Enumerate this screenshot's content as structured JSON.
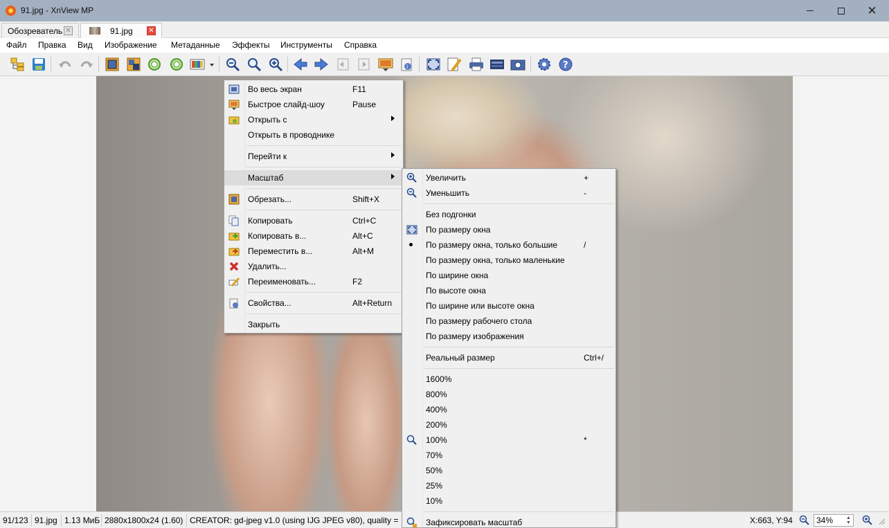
{
  "window": {
    "title": "91.jpg - XnView MP"
  },
  "tabs": [
    {
      "label": "Обозреватель"
    },
    {
      "label": "91.jpg"
    }
  ],
  "menubar": [
    "Файл",
    "Правка",
    "Вид",
    "Изображение",
    "Метаданные",
    "Эффекты",
    "Инструменты",
    "Справка"
  ],
  "context_menu": {
    "items": [
      {
        "label": "Во весь экран",
        "shortcut": "F11",
        "icon": "fullscreen-icon"
      },
      {
        "label": "Быстрое слайд-шоу",
        "shortcut": "Pause",
        "icon": "slideshow-icon"
      },
      {
        "label": "Открыть с",
        "shortcut": "",
        "icon": "open-with-icon"
      },
      {
        "label": "Открыть в проводнике",
        "shortcut": ""
      },
      {
        "label": "Перейти к",
        "shortcut": ""
      },
      {
        "label": "Масштаб",
        "shortcut": ""
      },
      {
        "label": "Обрезать...",
        "shortcut": "Shift+X",
        "icon": "crop-icon"
      },
      {
        "label": "Копировать",
        "shortcut": "Ctrl+C",
        "icon": "copy-icon"
      },
      {
        "label": "Копировать в...",
        "shortcut": "Alt+C",
        "icon": "copy-to-icon"
      },
      {
        "label": "Переместить в...",
        "shortcut": "Alt+M",
        "icon": "move-to-icon"
      },
      {
        "label": "Удалить...",
        "shortcut": "",
        "icon": "delete-icon"
      },
      {
        "label": "Переименовать...",
        "shortcut": "F2",
        "icon": "rename-icon"
      },
      {
        "label": "Свойства...",
        "shortcut": "Alt+Return",
        "icon": "properties-icon"
      },
      {
        "label": "Закрыть",
        "shortcut": ""
      }
    ]
  },
  "zoom_submenu": {
    "items": [
      {
        "label": "Увеличить",
        "shortcut": "+",
        "icon": "zoom-in-icon"
      },
      {
        "label": "Уменьшить",
        "shortcut": "-",
        "icon": "zoom-out-icon"
      },
      {
        "label": "Без подгонки",
        "shortcut": ""
      },
      {
        "label": "По размеру окна",
        "shortcut": "",
        "icon": "fit-window-icon"
      },
      {
        "label": "По размеру окна, только большие",
        "shortcut": "/",
        "selected": true
      },
      {
        "label": "По размеру окна, только маленькие",
        "shortcut": ""
      },
      {
        "label": "По ширине окна",
        "shortcut": ""
      },
      {
        "label": "По высоте окна",
        "shortcut": ""
      },
      {
        "label": "По ширине или высоте окна",
        "shortcut": ""
      },
      {
        "label": "По размеру рабочего стола",
        "shortcut": ""
      },
      {
        "label": "По размеру изображения",
        "shortcut": ""
      },
      {
        "label": "Реальный размер",
        "shortcut": "Ctrl+/"
      },
      {
        "label": "1600%",
        "shortcut": ""
      },
      {
        "label": "800%",
        "shortcut": ""
      },
      {
        "label": "400%",
        "shortcut": ""
      },
      {
        "label": "200%",
        "shortcut": ""
      },
      {
        "label": "100%",
        "shortcut": "*",
        "icon": "zoom-100-icon"
      },
      {
        "label": "70%",
        "shortcut": ""
      },
      {
        "label": "50%",
        "shortcut": ""
      },
      {
        "label": "25%",
        "shortcut": ""
      },
      {
        "label": "10%",
        "shortcut": ""
      },
      {
        "label": "Зафиксировать масштаб",
        "shortcut": "",
        "icon": "lock-zoom-icon"
      }
    ]
  },
  "statusbar": {
    "index": "91/123",
    "filename": "91.jpg",
    "filesize": "1.13 МиБ",
    "dimensions": "2880x1800x24 (1.60)",
    "comment": "CREATOR: gd-jpeg v1.0 (using IJG JPEG v80), quality =",
    "coords": "X:663, Y:94",
    "zoom": "34%"
  },
  "colors": {
    "titlebar": "#a3b0c2",
    "menu_bg": "#f0f0f0",
    "highlight": "#dcdcdc",
    "close_tab": "#e64a3c"
  }
}
